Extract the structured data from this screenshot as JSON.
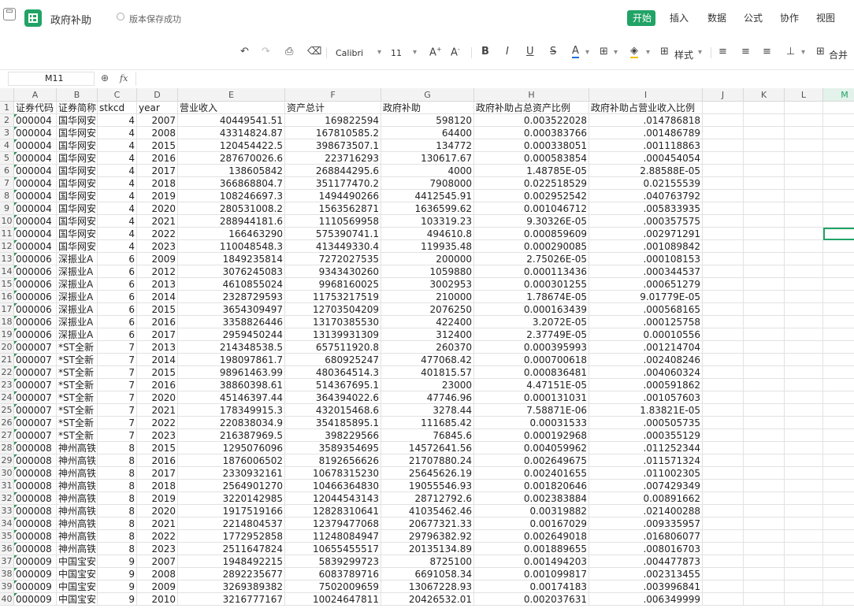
{
  "app": {
    "doc_title": "政府补助",
    "save_status": "版本保存成功",
    "menu": [
      "开始",
      "插入",
      "数据",
      "公式",
      "协作",
      "视图"
    ],
    "active_menu": "开始",
    "accent": "#21a366"
  },
  "toolbar": {
    "font_name": "Calibri",
    "font_size": "11",
    "style_label": "样式",
    "merge_label": "合并"
  },
  "formula_bar": {
    "name_box": "M11",
    "fx_label": "fx",
    "content": ""
  },
  "sheet": {
    "columns": [
      "A",
      "B",
      "C",
      "D",
      "E",
      "F",
      "G",
      "H",
      "I",
      "J",
      "K",
      "L",
      "M"
    ],
    "selected_cell": "M11",
    "header_row": [
      "证券代码",
      "证券简称",
      "stkcd",
      "year",
      "营业收入",
      "资产总计",
      "政府补助",
      "政府补助占总资产比例",
      "政府补助占营业收入比例"
    ],
    "rows": [
      [
        "000004",
        "国华网安",
        "4",
        "2007",
        "40449541.51",
        "169822594",
        "598120",
        "0.003522028",
        ".014786818"
      ],
      [
        "000004",
        "国华网安",
        "4",
        "2008",
        "43314824.87",
        "167810585.2",
        "64400",
        "0.000383766",
        ".001486789"
      ],
      [
        "000004",
        "国华网安",
        "4",
        "2015",
        "120454422.5",
        "398673507.1",
        "134772",
        "0.000338051",
        ".001118863"
      ],
      [
        "000004",
        "国华网安",
        "4",
        "2016",
        "287670026.6",
        "223716293",
        "130617.67",
        "0.000583854",
        ".000454054"
      ],
      [
        "000004",
        "国华网安",
        "4",
        "2017",
        "138605842",
        "268844295.6",
        "4000",
        "1.48785E-05",
        "2.88588E-05"
      ],
      [
        "000004",
        "国华网安",
        "4",
        "2018",
        "366868804.7",
        "351177470.2",
        "7908000",
        "0.022518529",
        "0.02155539"
      ],
      [
        "000004",
        "国华网安",
        "4",
        "2019",
        "108246697.3",
        "1494490266",
        "4412545.91",
        "0.002952542",
        ".040763792"
      ],
      [
        "000004",
        "国华网安",
        "4",
        "2020",
        "280531008.2",
        "1563562871",
        "1636599.62",
        "0.001046712",
        ".005833935"
      ],
      [
        "000004",
        "国华网安",
        "4",
        "2021",
        "288944181.6",
        "1110569958",
        "103319.23",
        "9.30326E-05",
        ".000357575"
      ],
      [
        "000004",
        "国华网安",
        "4",
        "2022",
        "166463290",
        "575390741.1",
        "494610.8",
        "0.000859609",
        ".002971291"
      ],
      [
        "000004",
        "国华网安",
        "4",
        "2023",
        "110048548.3",
        "413449330.4",
        "119935.48",
        "0.000290085",
        ".001089842"
      ],
      [
        "000006",
        "深振业A",
        "6",
        "2009",
        "1849235814",
        "7272027535",
        "200000",
        "2.75026E-05",
        ".000108153"
      ],
      [
        "000006",
        "深振业A",
        "6",
        "2012",
        "3076245083",
        "9343430260",
        "1059880",
        "0.000113436",
        ".000344537"
      ],
      [
        "000006",
        "深振业A",
        "6",
        "2013",
        "4610855024",
        "9968160025",
        "3002953",
        "0.000301255",
        ".000651279"
      ],
      [
        "000006",
        "深振业A",
        "6",
        "2014",
        "2328729593",
        "11753217519",
        "210000",
        "1.78674E-05",
        "9.01779E-05"
      ],
      [
        "000006",
        "深振业A",
        "6",
        "2015",
        "3654309497",
        "12703504209",
        "2076250",
        "0.000163439",
        ".000568165"
      ],
      [
        "000006",
        "深振业A",
        "6",
        "2016",
        "3358826446",
        "13170385530",
        "422400",
        "3.2072E-05",
        ".000125758"
      ],
      [
        "000006",
        "深振业A",
        "6",
        "2017",
        "2959450244",
        "13139931309",
        "312400",
        "2.37749E-05",
        "0.00010556"
      ],
      [
        "000007",
        "*ST全新",
        "7",
        "2013",
        "214348538.5",
        "657511920.8",
        "260370",
        "0.000395993",
        ".001214704"
      ],
      [
        "000007",
        "*ST全新",
        "7",
        "2014",
        "198097861.7",
        "680925247",
        "477068.42",
        "0.000700618",
        ".002408246"
      ],
      [
        "000007",
        "*ST全新",
        "7",
        "2015",
        "98961463.99",
        "480364514.3",
        "401815.57",
        "0.000836481",
        ".004060324"
      ],
      [
        "000007",
        "*ST全新",
        "7",
        "2016",
        "38860398.61",
        "514367695.1",
        "23000",
        "4.47151E-05",
        ".000591862"
      ],
      [
        "000007",
        "*ST全新",
        "7",
        "2020",
        "45146397.44",
        "364394022.6",
        "47746.96",
        "0.000131031",
        ".001057603"
      ],
      [
        "000007",
        "*ST全新",
        "7",
        "2021",
        "178349915.3",
        "432015468.6",
        "3278.44",
        "7.58871E-06",
        "1.83821E-05"
      ],
      [
        "000007",
        "*ST全新",
        "7",
        "2022",
        "220838034.9",
        "354185895.1",
        "111685.42",
        "0.00031533",
        ".000505735"
      ],
      [
        "000007",
        "*ST全新",
        "7",
        "2023",
        "216387969.5",
        "398229566",
        "76845.6",
        "0.000192968",
        ".000355129"
      ],
      [
        "000008",
        "神州高铁",
        "8",
        "2015",
        "1295076096",
        "3589354695",
        "14572641.56",
        "0.004059962",
        ".011252344"
      ],
      [
        "000008",
        "神州高铁",
        "8",
        "2016",
        "1876006502",
        "8192656626",
        "21707880.24",
        "0.002649675",
        ".011571324"
      ],
      [
        "000008",
        "神州高铁",
        "8",
        "2017",
        "2330932161",
        "10678315230",
        "25645626.19",
        "0.002401655",
        ".011002305"
      ],
      [
        "000008",
        "神州高铁",
        "8",
        "2018",
        "2564901270",
        "10466364830",
        "19055546.93",
        "0.001820646",
        ".007429349"
      ],
      [
        "000008",
        "神州高铁",
        "8",
        "2019",
        "3220142985",
        "12044543143",
        "28712792.6",
        "0.002383884",
        "0.00891662"
      ],
      [
        "000008",
        "神州高铁",
        "8",
        "2020",
        "1917519166",
        "12828310641",
        "41035462.46",
        "0.00319882",
        ".021400288"
      ],
      [
        "000008",
        "神州高铁",
        "8",
        "2021",
        "2214804537",
        "12379477068",
        "20677321.33",
        "0.00167029",
        ".009335957"
      ],
      [
        "000008",
        "神州高铁",
        "8",
        "2022",
        "1772952858",
        "11248084947",
        "29796382.92",
        "0.002649018",
        ".016806077"
      ],
      [
        "000008",
        "神州高铁",
        "8",
        "2023",
        "2511647824",
        "10655455517",
        "20135134.89",
        "0.001889655",
        ".008016703"
      ],
      [
        "000009",
        "中国宝安",
        "9",
        "2007",
        "1948492215",
        "5839299723",
        "8725100",
        "0.001494203",
        ".004477873"
      ],
      [
        "000009",
        "中国宝安",
        "9",
        "2008",
        "2892235677",
        "6083789716",
        "6691058.34",
        "0.001099817",
        ".002313455"
      ],
      [
        "000009",
        "中国宝安",
        "9",
        "2009",
        "3269389382",
        "7502009659",
        "13067228.93",
        "0.00174183",
        ".003996841"
      ],
      [
        "000009",
        "中国宝安",
        "9",
        "2010",
        "3216777167",
        "10024647811",
        "20426532.01",
        "0.002037631",
        ".006349999"
      ]
    ]
  }
}
